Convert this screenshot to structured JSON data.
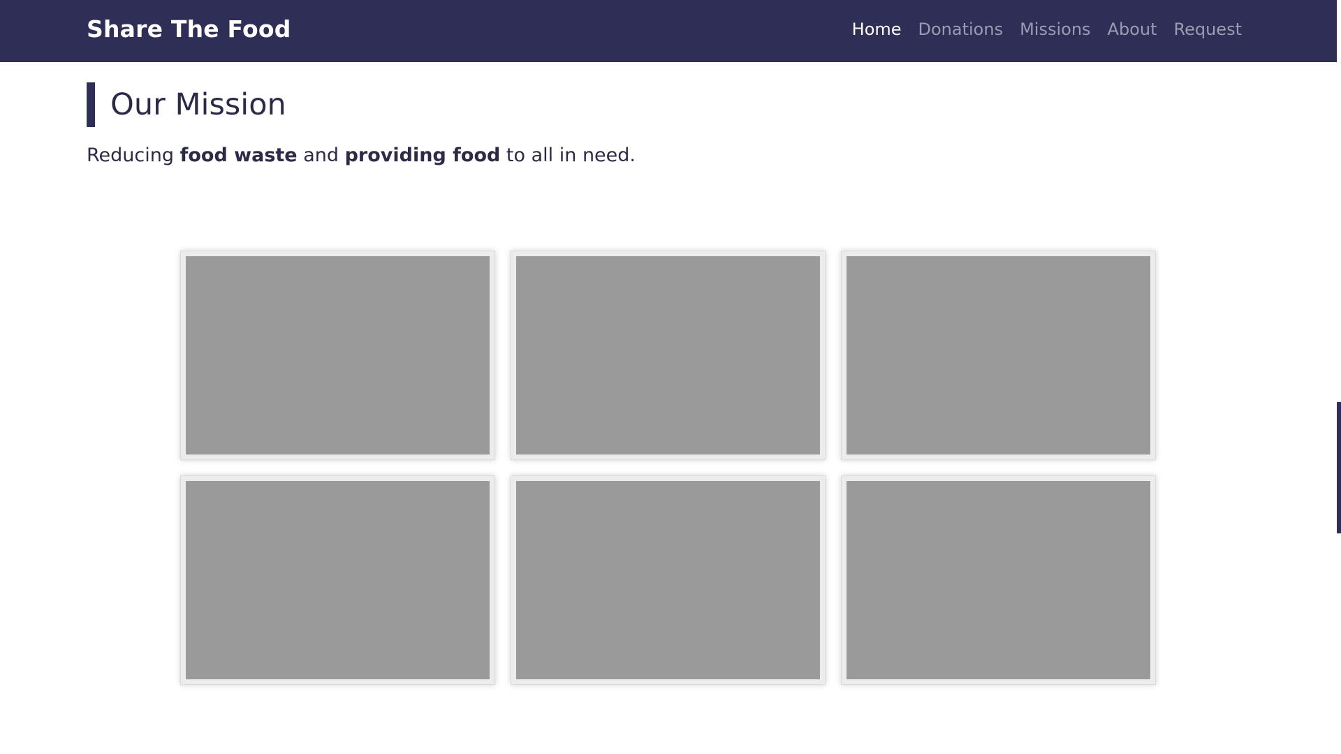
{
  "header": {
    "brand": "Share The Food",
    "nav": [
      {
        "label": "Home",
        "active": true
      },
      {
        "label": "Donations",
        "active": false
      },
      {
        "label": "Missions",
        "active": false
      },
      {
        "label": "About",
        "active": false
      },
      {
        "label": "Request",
        "active": false
      }
    ]
  },
  "mission": {
    "title": "Our Mission",
    "text_1": "Reducing ",
    "bold_1": "food waste",
    "text_2": " and ",
    "bold_2": "providing food",
    "text_3": " to all in need."
  },
  "colors": {
    "navbar_bg": "#2f2e56",
    "text": "#2b2b48",
    "nav_inactive": "#9c9bb3",
    "nav_active": "#ffffff"
  }
}
